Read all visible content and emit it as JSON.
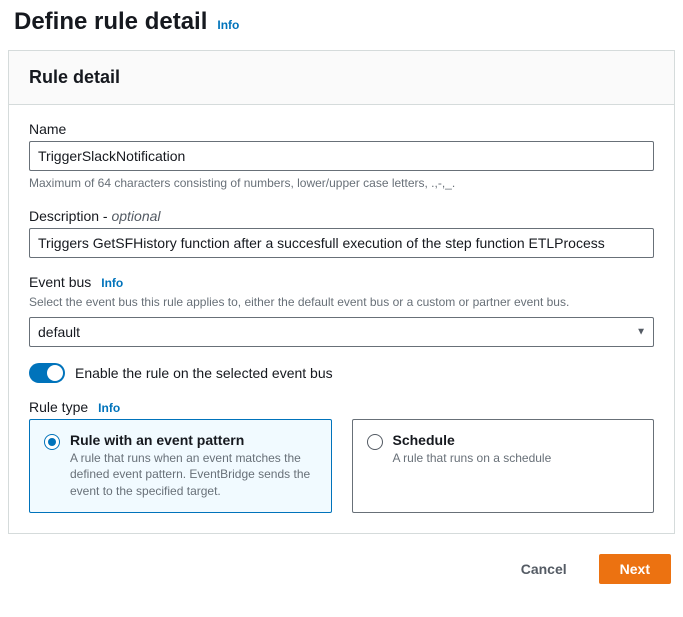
{
  "page": {
    "title": "Define rule detail",
    "info_label": "Info"
  },
  "panel": {
    "heading": "Rule detail"
  },
  "name": {
    "label": "Name",
    "value": "TriggerSlackNotification",
    "helper": "Maximum of 64 characters consisting of numbers, lower/upper case letters, .,-,_."
  },
  "description": {
    "label_main": "Description - ",
    "label_optional": "optional",
    "value": "Triggers GetSFHistory function after a succesfull execution of the step function ETLProcess"
  },
  "event_bus": {
    "label": "Event bus",
    "info_label": "Info",
    "helper": "Select the event bus this rule applies to, either the default event bus or a custom or partner event bus.",
    "selected": "default"
  },
  "enable_toggle": {
    "label": "Enable the rule on the selected event bus",
    "on": true
  },
  "rule_type": {
    "label": "Rule type",
    "info_label": "Info",
    "options": [
      {
        "title": "Rule with an event pattern",
        "desc": "A rule that runs when an event matches the defined event pattern. EventBridge sends the event to the specified target.",
        "selected": true
      },
      {
        "title": "Schedule",
        "desc": "A rule that runs on a schedule",
        "selected": false
      }
    ]
  },
  "footer": {
    "cancel": "Cancel",
    "next": "Next"
  }
}
